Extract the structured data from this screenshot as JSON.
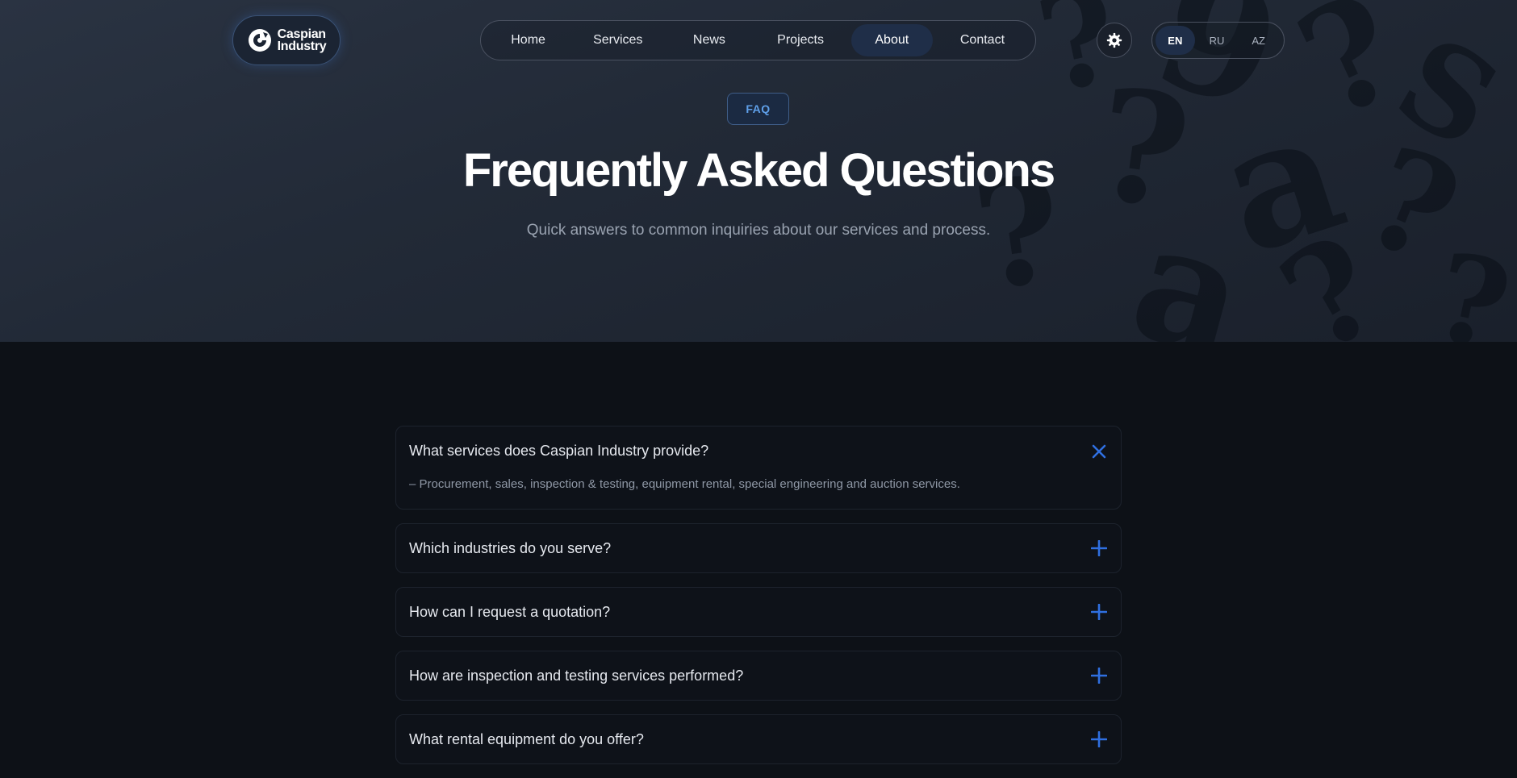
{
  "brand": {
    "line1": "Caspian",
    "line2": "Industry"
  },
  "nav": {
    "items": [
      {
        "label": "Home",
        "active": false
      },
      {
        "label": "Services",
        "active": false
      },
      {
        "label": "News",
        "active": false
      },
      {
        "label": "Projects",
        "active": false
      },
      {
        "label": "About",
        "active": true
      },
      {
        "label": "Contact",
        "active": false
      }
    ]
  },
  "theme_toggle": {
    "icon": "gear-icon"
  },
  "languages": {
    "items": [
      {
        "label": "EN",
        "active": true
      },
      {
        "label": "RU",
        "active": false
      },
      {
        "label": "AZ",
        "active": false
      }
    ]
  },
  "hero": {
    "badge": "FAQ",
    "title": "Frequently Asked Questions",
    "subtitle": "Quick answers to common inquiries about our services and process."
  },
  "faq": {
    "items": [
      {
        "question": "What services does Caspian Industry provide?",
        "answer": "– Procurement, sales, inspection & testing, equipment rental, special engineering and auction services.",
        "open": true
      },
      {
        "question": "Which industries do you serve?",
        "open": false
      },
      {
        "question": "How can I request a quotation?",
        "open": false
      },
      {
        "question": "How are inspection and testing services performed?",
        "open": false
      },
      {
        "question": "What rental equipment do you offer?",
        "open": false
      }
    ]
  },
  "colors": {
    "accent": "#2f6fe0",
    "badge_text": "#5fa0ea",
    "background": "#0d1117"
  }
}
